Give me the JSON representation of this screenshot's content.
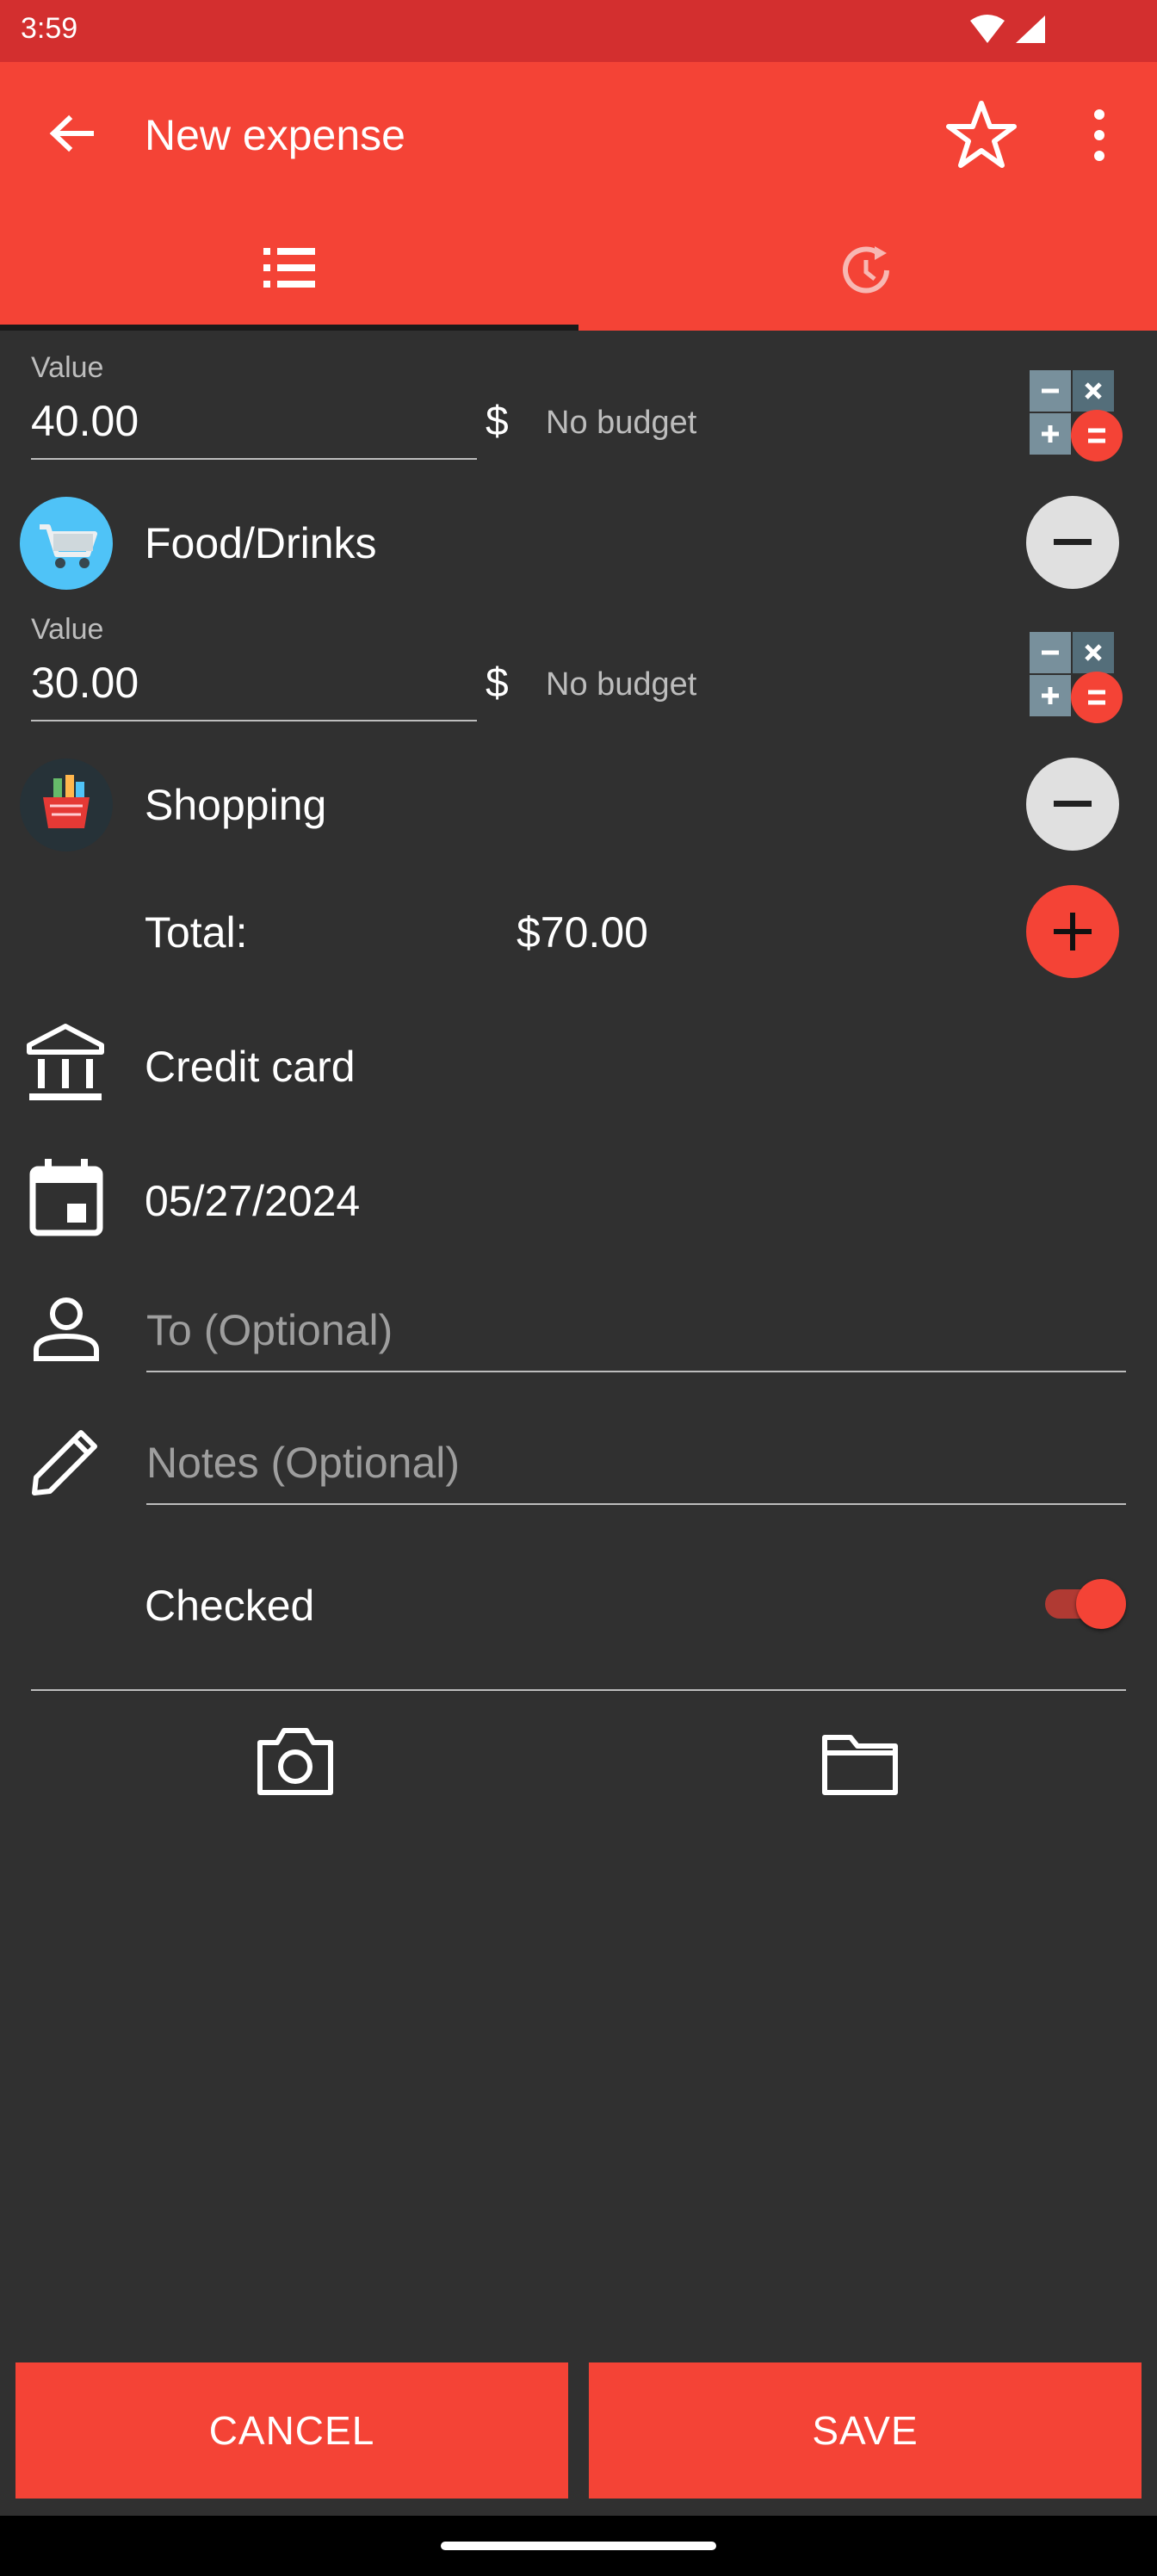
{
  "status_bar": {
    "time": "3:59"
  },
  "app_bar": {
    "title": "New expense"
  },
  "tabs": [
    {
      "icon": "list-icon"
    },
    {
      "icon": "history-icon"
    }
  ],
  "splits": [
    {
      "value_label": "Value",
      "value": "40.00",
      "currency": "$",
      "budget": "No budget",
      "category": "Food/Drinks"
    },
    {
      "value_label": "Value",
      "value": "30.00",
      "currency": "$",
      "budget": "No budget",
      "category": "Shopping"
    }
  ],
  "total": {
    "label": "Total:",
    "amount": "$70.00"
  },
  "account": {
    "label": "Credit card"
  },
  "date": {
    "value": "05/27/2024"
  },
  "to_field": {
    "placeholder": "To (Optional)"
  },
  "notes_field": {
    "placeholder": "Notes (Optional)"
  },
  "checked": {
    "label": "Checked",
    "on": true
  },
  "buttons": {
    "cancel": "CANCEL",
    "save": "SAVE"
  },
  "colors": {
    "primary": "#f44336",
    "primary_dark": "#d32f2f",
    "background": "#303030"
  }
}
